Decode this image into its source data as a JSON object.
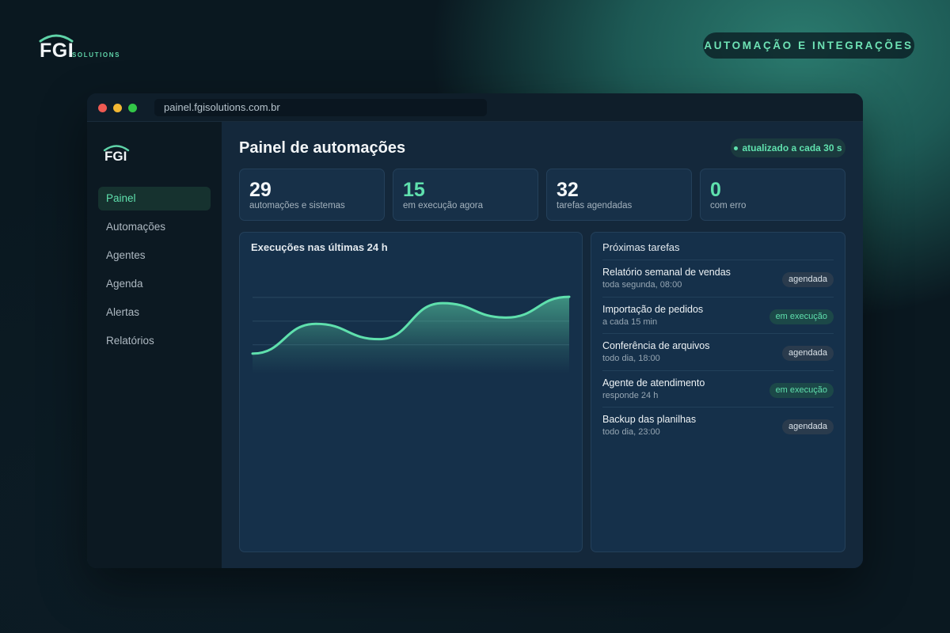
{
  "brand": {
    "name": "FGI",
    "sub": "SOLUTIONS",
    "tagline": "AUTOMAÇÃO E INTEGRAÇÕES"
  },
  "browser": {
    "url": "painel.fgisolutions.com.br"
  },
  "sidebar": {
    "logo": "FGI",
    "items": [
      {
        "label": "Painel",
        "active": true
      },
      {
        "label": "Automações",
        "active": false
      },
      {
        "label": "Agentes",
        "active": false
      },
      {
        "label": "Agenda",
        "active": false
      },
      {
        "label": "Alertas",
        "active": false
      },
      {
        "label": "Relatórios",
        "active": false
      }
    ]
  },
  "main": {
    "title": "Painel de automações",
    "status": "atualizado a cada 30 s",
    "stats": [
      {
        "value": "29",
        "label": "automações e sistemas"
      },
      {
        "value": "15",
        "label": "em execução agora"
      },
      {
        "value": "32",
        "label": "tarefas agendadas"
      },
      {
        "value": "0",
        "label": "com erro"
      }
    ],
    "chart_title": "Execuções nas últimas 24 h",
    "tasks_title": "Próximas tarefas",
    "tasks": [
      {
        "name": "Relatório semanal de vendas",
        "schedule": "toda segunda, 08:00",
        "status": "agendada",
        "kind": "scheduled"
      },
      {
        "name": "Importação de pedidos",
        "schedule": "a cada 15 min",
        "status": "em execução",
        "kind": "running"
      },
      {
        "name": "Conferência de arquivos",
        "schedule": "todo dia, 18:00",
        "status": "agendada",
        "kind": "scheduled"
      },
      {
        "name": "Agente de atendimento",
        "schedule": "responde 24 h",
        "status": "em execução",
        "kind": "running"
      },
      {
        "name": "Backup das planilhas",
        "schedule": "todo dia, 23:00",
        "status": "agendada",
        "kind": "scheduled"
      }
    ]
  },
  "colors": {
    "accent": "#5fe0ad",
    "background": "#0b1a22",
    "panel": "#14283b"
  },
  "chart_data": {
    "type": "area",
    "title": "Execuções nas últimas 24 h",
    "x": [
      0,
      1,
      2,
      3,
      4,
      5
    ],
    "values": [
      22,
      55,
      38,
      78,
      62,
      85
    ],
    "ylim": [
      0,
      100
    ],
    "grid": true
  }
}
